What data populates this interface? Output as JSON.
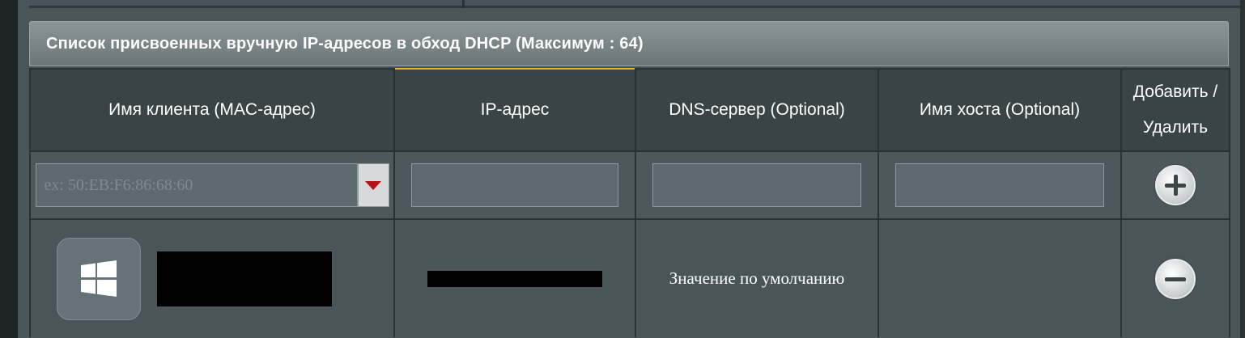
{
  "section": {
    "title": "Список присвоенных вручную IP-адресов в обход DHCP (Максимум : 64)"
  },
  "table": {
    "headers": {
      "client": "Имя клиента (MAC-адрес)",
      "ip": "IP-адрес",
      "dns": "DNS-сервер (Optional)",
      "hostname": "Имя хоста (Optional)",
      "add_remove": "Добавить / Удалить"
    },
    "input_row": {
      "mac_placeholder": "ex: 50:EB:F6:86:68:60",
      "ip_value": "",
      "dns_value": "",
      "hostname_value": ""
    },
    "rows": [
      {
        "os_icon": "windows-icon",
        "client_name": "",
        "ip": "",
        "dns": "Значение по умолчанию",
        "hostname": ""
      }
    ]
  },
  "icons": {
    "add": "plus-circle-icon",
    "remove": "minus-circle-icon",
    "dropdown": "triangle-down-icon"
  },
  "colors": {
    "accent_active_tab": "#e6b422",
    "dropdown_arrow": "#b3121a"
  }
}
